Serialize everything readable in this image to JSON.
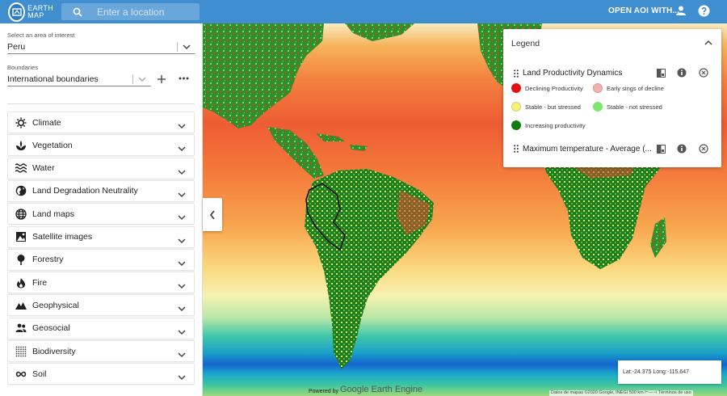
{
  "app": {
    "logo_line1": "EARTH",
    "logo_line2": "MAP"
  },
  "search": {
    "placeholder": "Enter a location"
  },
  "header": {
    "open_aoi": "OPEN AOI WITH..."
  },
  "sidebar": {
    "aoi_label": "Select an area of interest",
    "aoi_value": "Peru",
    "boundaries_label": "Boundaries",
    "boundaries_value": "International boundaries",
    "categories": [
      {
        "label": "Climate",
        "icon": "sun-icon"
      },
      {
        "label": "Vegetation",
        "icon": "plant-icon"
      },
      {
        "label": "Water",
        "icon": "waves-icon"
      },
      {
        "label": "Land Degradation Neutrality",
        "icon": "globe-icon"
      },
      {
        "label": "Land maps",
        "icon": "globe-grid-icon"
      },
      {
        "label": "Satellite images",
        "icon": "image-icon"
      },
      {
        "label": "Forestry",
        "icon": "tree-icon"
      },
      {
        "label": "Fire",
        "icon": "fire-icon"
      },
      {
        "label": "Geophysical",
        "icon": "terrain-icon"
      },
      {
        "label": "Geosocial",
        "icon": "people-icon"
      },
      {
        "label": "Biodiversity",
        "icon": "dots-grid-icon"
      },
      {
        "label": "Soil",
        "icon": "infinity-icon"
      }
    ]
  },
  "legend": {
    "title": "Legend",
    "layer1": {
      "title": "Land Productivity Dynamics",
      "items": [
        {
          "label": "Declining Productivity",
          "color": "#e21212"
        },
        {
          "label": "Early sings of decline",
          "color": "#f2b0b0"
        },
        {
          "label": "Stable - but stressed",
          "color": "#f6f370"
        },
        {
          "label": "Stable - not stressed",
          "color": "#7ee66e"
        },
        {
          "label": "Increasing productivity",
          "color": "#117d11"
        }
      ]
    },
    "layer2": {
      "title": "Maximum temperature - Average (..."
    }
  },
  "map": {
    "coords": "Lat:-24.375 Long:-115.647",
    "powered_by": "Powered by",
    "engine": "Google Earth Engine",
    "attribution": "Datos de mapas ©2020 Google, INEGI   500 km ⊢—⊣   Términos de uso"
  },
  "colors": {
    "header": "#3f8ed0"
  }
}
